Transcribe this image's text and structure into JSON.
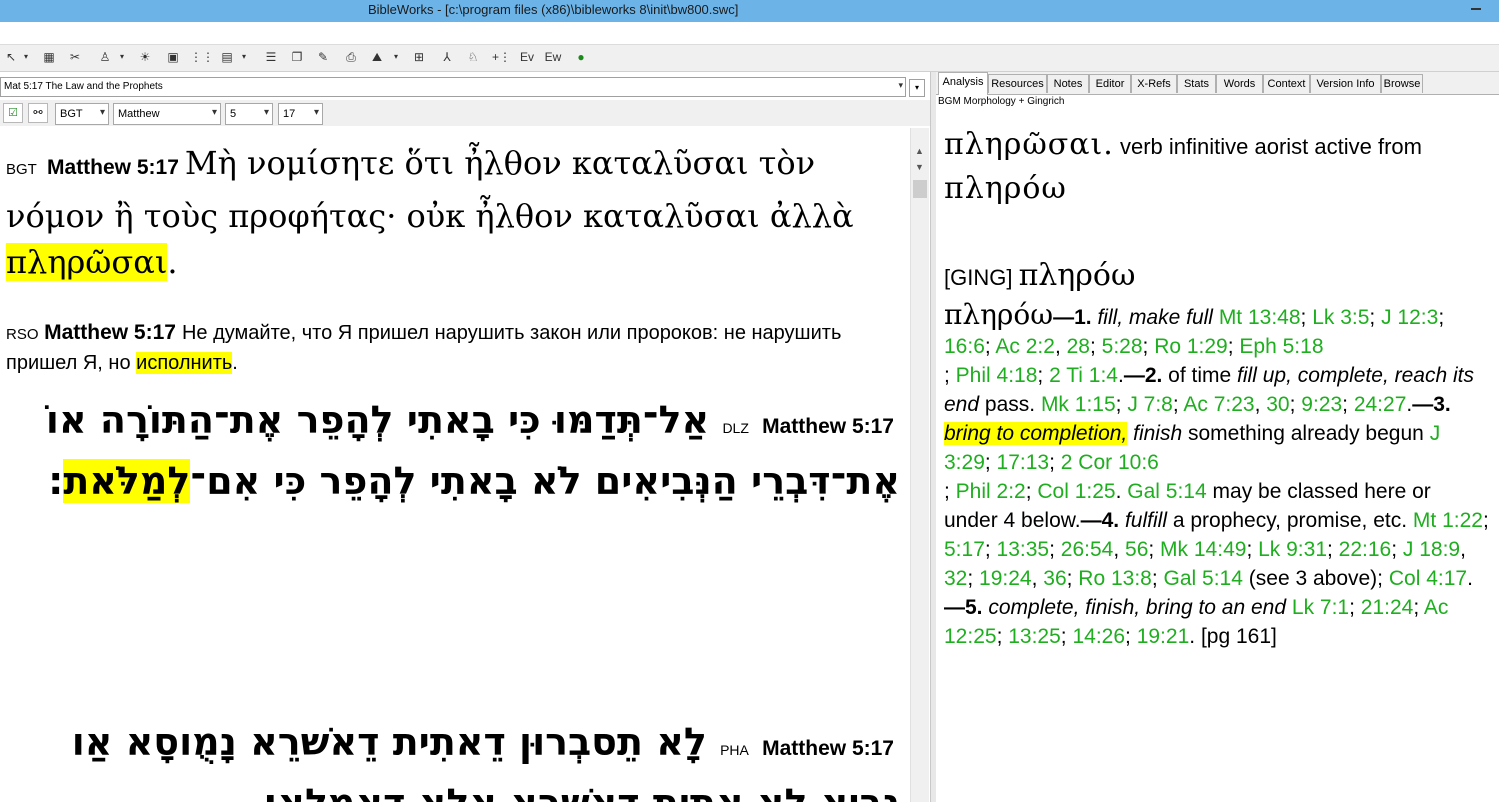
{
  "window": {
    "title": "BibleWorks - [c:\\program files (x86)\\bibleworks 8\\init\\bw800.swc]"
  },
  "toolbar": {
    "icons": [
      "cursor-icon",
      "save-icon",
      "tools-icon",
      "user-icon",
      "verse-icon",
      "window-icon",
      "columns-icon",
      "grid-icon",
      "list-icon",
      "copy-icon",
      "edit-icon",
      "print-icon",
      "map-icon",
      "layout-icon",
      "lexicon-icon",
      "search-icon",
      "add-icon",
      "ev-icon",
      "ew-icon",
      "globe-icon"
    ]
  },
  "left": {
    "verse_list": "Mat 5:17 The Law and the Prophets",
    "version": "BGT",
    "book": "Matthew",
    "chapter": "5",
    "verse": "17",
    "bgt": {
      "abbr": "BGT",
      "ref": "Matthew 5:17",
      "text_before": "Μὴ νομίσητε ὅτι ἦλθον καταλῦσαι τὸν νόμον ἢ τοὺς προφήτας· οὐκ ἦλθον καταλῦσαι ἀλλὰ ",
      "highlight": "πληρῶσαι",
      "text_after": "."
    },
    "rso": {
      "abbr": "RSO",
      "ref": "Matthew 5:17",
      "text_before": "Не думайте, что Я пришел нарушить закон или пророков: не нарушить пришел Я, но ",
      "highlight": "исполнить",
      "text_after": "."
    },
    "dlz": {
      "abbr": "DLZ",
      "ref": "Matthew 5:17",
      "text_before": "אַל־תְּדַמּוּ כִּי בָאתִי לְהָפֵר אֶת־הַתּוֹרָה אוֹ אֶת־דִּבְרֵי הַנְּבִיאִים לֹא בָאתִי לְהָפֵר כִּי אִם־",
      "highlight": "לְמַלֹּאת",
      "text_after": ":"
    },
    "pha": {
      "abbr": "PHA",
      "ref": "Matthew 5:17",
      "text": "לָא תֵסבְרוּן דֵאתִית דֵאשׁרֵא נָמֻוסָא אַו נבִיֵאָ לָא אֵתִית דֵאשׁרֵא אֶלָא דֵאמַלֵא׃"
    }
  },
  "right": {
    "tabs": [
      "Analysis",
      "Resources",
      "Notes",
      "Editor",
      "X-Refs",
      "Stats",
      "Words",
      "Context",
      "Version Info",
      "Browse"
    ],
    "source": "BGM Morphology + Gingrich",
    "parse_word": "πληρῶσαι.",
    "parse_desc": "verb infinitive aorist active from",
    "parse_lemma": "πληρόω",
    "ging_tag": "[GING]",
    "ging_lemma": "πληρόω",
    "entry_lemma": "πληρόω",
    "entry": {
      "s1_num": "—1.",
      "s1_def": "fill, make full",
      "s1_refs_a": [
        "Mt 13:48",
        "Lk 3:5",
        "J 12:3",
        "16:6",
        "Ac 2:2",
        "28",
        "5:28",
        "Ro 1:29",
        "Eph 5:18",
        "Phil 4:18",
        "2 Ti 1:4"
      ],
      "s2_num": "—2.",
      "s2_pre": "of time",
      "s2_def": "fill up, complete, reach its end",
      "s2_post": "pass.",
      "s2_refs": [
        "Mk 1:15",
        "J 7:8",
        "Ac 7:23",
        "30",
        "9:23",
        "24:27"
      ],
      "s3_num": "—3.",
      "s3_def_hl": "bring to completion,",
      "s3_def": "finish",
      "s3_post": "something already begun",
      "s3_refs": [
        "J 3:29",
        "17:13",
        "2 Cor 10:6",
        "Phil 2:2",
        "Col 1:25",
        "Gal 5:14"
      ],
      "s3_tail": "may be classed here or under 4 below.",
      "s4_num": "—4.",
      "s4_def": "fulfill",
      "s4_post": "a prophecy, promise, etc.",
      "s4_refs": [
        "Mt 1:22",
        "5:17",
        "13:35",
        "26:54",
        "56",
        "Mk 14:49",
        "Lk 9:31",
        "22:16",
        "J 18:9",
        "32",
        "19:24",
        "36",
        "Ro 13:8",
        "Gal 5:14"
      ],
      "s4_note": "(see 3 above);",
      "s4_ref_last": "Col 4:17",
      "s5_num": "—5.",
      "s5_def": "complete, finish, bring to an end",
      "s5_refs": [
        "Lk 7:1",
        "21:24",
        "Ac 12:25",
        "13:25",
        "14:26",
        "19:21"
      ],
      "page": "[pg 161]"
    }
  },
  "colors": {
    "titlebar": "#6cb4e8",
    "highlight": "#ffff00",
    "reference": "#1fae1f"
  }
}
